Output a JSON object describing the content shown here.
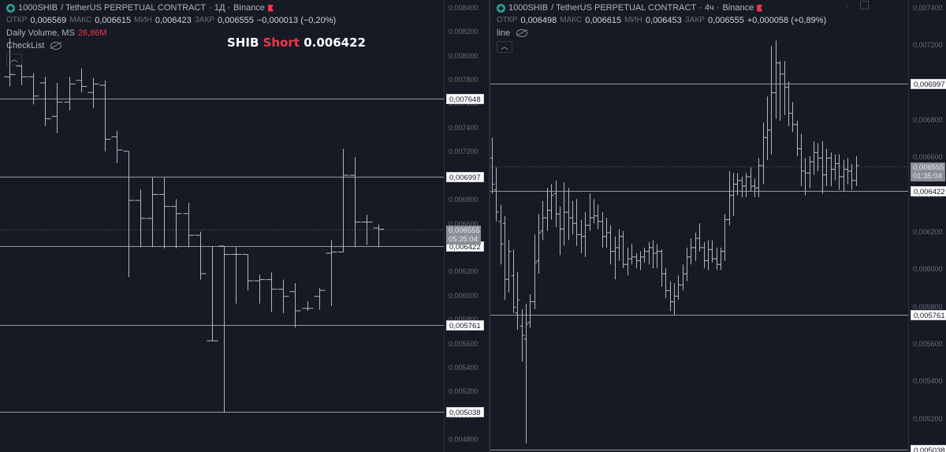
{
  "left": {
    "logo_icon": "shib-diamond-logo",
    "symbol": "1000SHIB",
    "pair": "/ TetherUS PERPETUAL CONTRACT",
    "interval": "· 1Д ·",
    "exchange": "Binance",
    "ohlc": {
      "open_label": "ОТКР",
      "open": "0,006569",
      "high_label": "МАКС",
      "high": "0,006615",
      "low_label": "МИН",
      "low": "0,006423",
      "close_label": "ЗАКР",
      "close": "0,006555",
      "change": "−0,000013 (−0,20%)"
    },
    "volume_label": "Daily Volume, MS",
    "volume_value": "26,86M",
    "checklist_label": "CheckList",
    "collapse_icon": "chevron-up-icon",
    "overlay": {
      "prefix": "SHIB",
      "side": "Short",
      "price": "0.006422"
    },
    "ticks": [
      "0,008400",
      "0,008200",
      "0,008000",
      "0,007800",
      "0,007600",
      "0,007400",
      "0,007200",
      "0,007000",
      "0,006800",
      "0,006600",
      "0,006400",
      "0,006200",
      "0,006000",
      "0,005800",
      "0,005600",
      "0,005400",
      "0,005200",
      "0,005000",
      "0,004800"
    ],
    "levels": [
      "0,007648",
      "0,006997",
      "0,006422",
      "0,005761",
      "0,005038"
    ],
    "current_price": "0,006555",
    "countdown": "05:35:04"
  },
  "right": {
    "logo_icon": "shib-diamond-logo",
    "symbol": "1000SHIB",
    "pair": "/ TetherUS PERPETUAL CONTRACT",
    "interval": "· 4ч ·",
    "exchange": "Binance",
    "ohlc": {
      "open_label": "ОТКР",
      "open": "0,006498",
      "high_label": "МАКС",
      "high": "0,006615",
      "low_label": "МИН",
      "low": "0,006453",
      "close_label": "ЗАКР",
      "close": "0,006555",
      "change": "+0,000058 (+0,89%)"
    },
    "line_label": "line",
    "collapse_icon": "chevron-up-icon",
    "ticks": [
      "0,007400",
      "0,007200",
      "0,007000",
      "0,006800",
      "0,006600",
      "0,006400",
      "0,006200",
      "0,006000",
      "0,005800",
      "0,005600",
      "0,005400",
      "0,005200",
      "0,005000"
    ],
    "levels": [
      "0,006997",
      "0,006422",
      "0,005761",
      "0,005038"
    ],
    "current_price": "0,006555",
    "countdown": "01:35:04"
  },
  "colors": {
    "background": "#161a25",
    "bars": "#b2b5be",
    "level_line": "#9598a1",
    "accent_red": "#f23645",
    "logo_teal": "#26a69a"
  },
  "chart_data": [
    {
      "type": "ohlc",
      "series": [
        {
          "name": "1000SHIB / TetherUS PERPETUAL CONTRACT · 1Д",
          "ohlc": [
            [
              0.00783,
              0.00815,
              0.00775,
              0.00785
            ],
            [
              0.00792,
              0.00798,
              0.00776,
              0.00783
            ],
            [
              0.00783,
              0.00786,
              0.0076,
              0.00767
            ],
            [
              0.00778,
              0.00783,
              0.00742,
              0.00748
            ],
            [
              0.0075,
              0.00778,
              0.00736,
              0.00762
            ],
            [
              0.00762,
              0.00783,
              0.00755,
              0.00777
            ],
            [
              0.0078,
              0.0079,
              0.0077,
              0.00775
            ],
            [
              0.0077,
              0.00782,
              0.00757,
              0.00777
            ],
            [
              0.00776,
              0.0078,
              0.00721,
              0.00731
            ],
            [
              0.00733,
              0.00738,
              0.00711,
              0.00722
            ],
            [
              0.00721,
              0.00721,
              0.00616,
              0.0068
            ],
            [
              0.0068,
              0.00689,
              0.00641,
              0.00665
            ],
            [
              0.00665,
              0.00699,
              0.00641,
              0.00685
            ],
            [
              0.00685,
              0.00699,
              0.0064,
              0.00675
            ],
            [
              0.00675,
              0.00681,
              0.0064,
              0.00669
            ],
            [
              0.00669,
              0.00678,
              0.00641,
              0.00651
            ],
            [
              0.00651,
              0.00654,
              0.00614,
              0.00619
            ],
            [
              0.00563,
              0.00642,
              0.00563,
              0.00563
            ],
            [
              0.00642,
              0.00642,
              0.00503,
              0.00635
            ],
            [
              0.00635,
              0.00641,
              0.00594,
              0.00635
            ],
            [
              0.00635,
              0.00635,
              0.00605,
              0.00613
            ],
            [
              0.00613,
              0.00618,
              0.00594,
              0.00614
            ],
            [
              0.00614,
              0.0062,
              0.00587,
              0.00606
            ],
            [
              0.00606,
              0.00614,
              0.00586,
              0.006
            ],
            [
              0.00604,
              0.00611,
              0.00574,
              0.00588
            ],
            [
              0.0059,
              0.00596,
              0.00588,
              0.0059
            ],
            [
              0.006,
              0.00607,
              0.00589,
              0.00605
            ],
            [
              0.00636,
              0.00647,
              0.00592,
              0.00637
            ],
            [
              0.00637,
              0.00723,
              0.00637,
              0.00701
            ],
            [
              0.00701,
              0.00716,
              0.00641,
              0.00662
            ],
            [
              0.00662,
              0.00668,
              0.00643,
              0.00662
            ],
            [
              0.00657,
              0.0066,
              0.00641,
              0.00656
            ]
          ]
        }
      ],
      "levels": [
        0.007648,
        0.006997,
        0.006422,
        0.005761,
        0.005038
      ],
      "ylim": [
        0.0047,
        0.0085
      ]
    },
    {
      "type": "ohlc",
      "series": [
        {
          "name": "1000SHIB / TetherUS PERPETUAL CONTRACT · 4ч",
          "ohlc": [
            [
              0.0066,
              0.00671,
              0.00641,
              0.00646
            ],
            [
              0.00643,
              0.00655,
              0.00626,
              0.00631
            ],
            [
              0.00626,
              0.00635,
              0.00603,
              0.00614
            ],
            [
              0.00625,
              0.00629,
              0.00584,
              0.00595
            ],
            [
              0.00595,
              0.00616,
              0.00588,
              0.0061
            ],
            [
              0.00597,
              0.00611,
              0.00577,
              0.0058
            ],
            [
              0.00577,
              0.00599,
              0.00568,
              0.00584
            ],
            [
              0.0057,
              0.00579,
              0.00551,
              0.00565
            ],
            [
              0.00563,
              0.00582,
              0.00507,
              0.00571
            ],
            [
              0.00572,
              0.00587,
              0.00569,
              0.00583
            ],
            [
              0.00583,
              0.00619,
              0.00579,
              0.00604
            ],
            [
              0.00605,
              0.0063,
              0.00598,
              0.0062
            ],
            [
              0.00621,
              0.00637,
              0.00616,
              0.00628
            ],
            [
              0.00628,
              0.00644,
              0.00621,
              0.00632
            ],
            [
              0.00632,
              0.00646,
              0.00627,
              0.0064
            ],
            [
              0.00641,
              0.00648,
              0.00623,
              0.0063
            ],
            [
              0.0063,
              0.00634,
              0.00608,
              0.00622
            ],
            [
              0.00622,
              0.00647,
              0.00613,
              0.00631
            ],
            [
              0.00631,
              0.00644,
              0.00616,
              0.00628
            ],
            [
              0.00628,
              0.00637,
              0.00619,
              0.00625
            ],
            [
              0.00625,
              0.00638,
              0.00613,
              0.00619
            ],
            [
              0.00619,
              0.00627,
              0.00609,
              0.00618
            ],
            [
              0.00618,
              0.00631,
              0.00607,
              0.00624
            ],
            [
              0.00624,
              0.00641,
              0.00621,
              0.00628
            ],
            [
              0.00628,
              0.00638,
              0.00625,
              0.00629
            ],
            [
              0.00629,
              0.00635,
              0.00622,
              0.00626
            ],
            [
              0.00626,
              0.00631,
              0.00612,
              0.00618
            ],
            [
              0.00618,
              0.00628,
              0.00612,
              0.0062
            ],
            [
              0.0062,
              0.00624,
              0.00603,
              0.0061
            ],
            [
              0.0061,
              0.00618,
              0.00595,
              0.00612
            ],
            [
              0.00612,
              0.00622,
              0.00605,
              0.00618
            ],
            [
              0.00618,
              0.00621,
              0.00601,
              0.00603
            ],
            [
              0.00603,
              0.00612,
              0.00597,
              0.00606
            ],
            [
              0.00606,
              0.00614,
              0.00603,
              0.00607
            ],
            [
              0.00607,
              0.00609,
              0.00601,
              0.00605
            ],
            [
              0.00605,
              0.0061,
              0.006,
              0.00607
            ],
            [
              0.00607,
              0.00612,
              0.00604,
              0.0061
            ],
            [
              0.0061,
              0.00615,
              0.00603,
              0.00612
            ],
            [
              0.00612,
              0.00616,
              0.00601,
              0.00609
            ],
            [
              0.00609,
              0.00614,
              0.00601,
              0.0061
            ],
            [
              0.0061,
              0.00611,
              0.00591,
              0.00598
            ],
            [
              0.00598,
              0.00601,
              0.00585,
              0.00589
            ],
            [
              0.00589,
              0.00594,
              0.00578,
              0.00583
            ],
            [
              0.00583,
              0.00593,
              0.00576,
              0.00586
            ],
            [
              0.00586,
              0.00597,
              0.00584,
              0.00592
            ],
            [
              0.00592,
              0.00603,
              0.00589,
              0.00598
            ],
            [
              0.00598,
              0.00612,
              0.00594,
              0.00607
            ],
            [
              0.00607,
              0.00617,
              0.00603,
              0.00612
            ],
            [
              0.00612,
              0.0062,
              0.00605,
              0.00617
            ],
            [
              0.00617,
              0.00625,
              0.0061,
              0.00612
            ],
            [
              0.00612,
              0.00615,
              0.00601,
              0.00605
            ],
            [
              0.00605,
              0.00616,
              0.006,
              0.00611
            ],
            [
              0.00611,
              0.00616,
              0.00604,
              0.00606
            ],
            [
              0.00606,
              0.00612,
              0.006,
              0.00603
            ],
            [
              0.00603,
              0.00612,
              0.006,
              0.0061
            ],
            [
              0.0061,
              0.0063,
              0.00605,
              0.00627
            ],
            [
              0.00627,
              0.00653,
              0.00624,
              0.0064
            ],
            [
              0.0064,
              0.00652,
              0.00629,
              0.00646
            ],
            [
              0.00646,
              0.00652,
              0.0064,
              0.00648
            ],
            [
              0.00648,
              0.0065,
              0.00639,
              0.00645
            ],
            [
              0.00645,
              0.00652,
              0.00639,
              0.0065
            ],
            [
              0.0065,
              0.00655,
              0.00642,
              0.00645
            ],
            [
              0.00645,
              0.00649,
              0.00639,
              0.00644
            ],
            [
              0.00644,
              0.0066,
              0.00639,
              0.00656
            ],
            [
              0.00656,
              0.00679,
              0.00646,
              0.00671
            ],
            [
              0.00671,
              0.00693,
              0.00659,
              0.00675
            ],
            [
              0.00675,
              0.0072,
              0.00662,
              0.00695
            ],
            [
              0.00695,
              0.00723,
              0.00681,
              0.00711
            ],
            [
              0.00711,
              0.00712,
              0.0068,
              0.00705
            ],
            [
              0.00705,
              0.00712,
              0.00683,
              0.00698
            ],
            [
              0.00698,
              0.00701,
              0.00677,
              0.00684
            ],
            [
              0.00684,
              0.0069,
              0.00674,
              0.00678
            ],
            [
              0.00678,
              0.0068,
              0.00661,
              0.00665
            ],
            [
              0.00665,
              0.00673,
              0.00645,
              0.00653
            ],
            [
              0.00653,
              0.0066,
              0.0064,
              0.00652
            ],
            [
              0.00652,
              0.00661,
              0.00644,
              0.00658
            ],
            [
              0.00658,
              0.00669,
              0.00651,
              0.00663
            ],
            [
              0.00663,
              0.00668,
              0.00653,
              0.0066
            ],
            [
              0.0066,
              0.00669,
              0.00641,
              0.00651
            ],
            [
              0.00651,
              0.00665,
              0.00645,
              0.0066
            ],
            [
              0.0066,
              0.00663,
              0.00645,
              0.00654
            ],
            [
              0.00654,
              0.00662,
              0.00648,
              0.00657
            ],
            [
              0.00657,
              0.00662,
              0.00643,
              0.0065
            ],
            [
              0.0065,
              0.00659,
              0.00642,
              0.00654
            ],
            [
              0.00654,
              0.0066,
              0.00646,
              0.00653
            ],
            [
              0.00653,
              0.00657,
              0.00643,
              0.00648
            ],
            [
              0.00648,
              0.00661,
              0.00645,
              0.00656
            ]
          ]
        }
      ],
      "levels": [
        0.006997,
        0.006422,
        0.005761,
        0.005038
      ],
      "ylim": [
        0.0049,
        0.0075
      ]
    }
  ]
}
